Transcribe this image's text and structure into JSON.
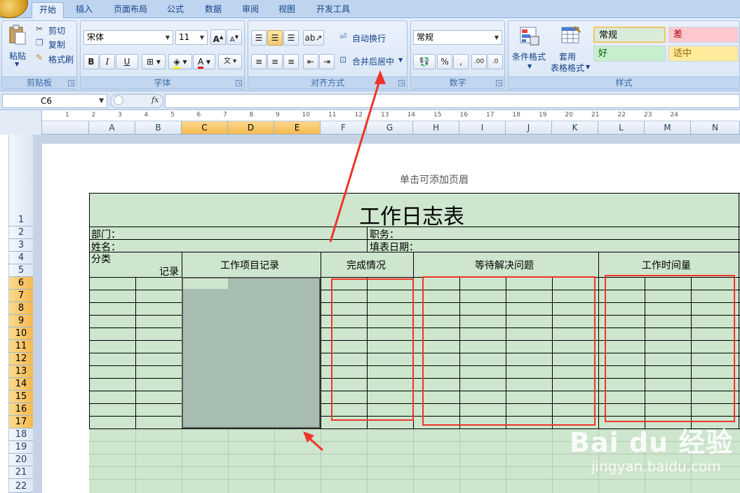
{
  "tabs": [
    "开始",
    "插入",
    "页面布局",
    "公式",
    "数据",
    "审阅",
    "视图",
    "开发工具"
  ],
  "clipboard": {
    "paste": "粘贴",
    "cut": "剪切",
    "copy": "复制",
    "format_painter": "格式刷",
    "label": "剪贴板"
  },
  "font": {
    "name": "宋体",
    "size": "11",
    "bold": "B",
    "italic": "I",
    "underline": "U",
    "label": "字体"
  },
  "alignment": {
    "wrap": "自动换行",
    "merge": "合并后居中",
    "label": "对齐方式"
  },
  "number": {
    "format": "常规",
    "percent": "%",
    "comma": ",",
    "label": "数字"
  },
  "styles": {
    "conditional": "条件格式",
    "table_format": "套用\n表格格式",
    "table_format_line1": "套用",
    "table_format_line2": "表格格式",
    "normal": "常规",
    "bad": "差",
    "good": "好",
    "neutral": "适中",
    "label": "样式",
    "colors": {
      "normal": "#d9ecd9",
      "bad": "#ffc7ce",
      "good": "#c6efce",
      "neutral": "#ffeb9c"
    }
  },
  "name_box": "C6",
  "fx": "fx",
  "columns": [
    "A",
    "B",
    "C",
    "D",
    "E",
    "F",
    "G",
    "H",
    "I",
    "J",
    "K",
    "L",
    "M",
    "N"
  ],
  "selected_columns": [
    "C",
    "D",
    "E"
  ],
  "ruler_numbers": [
    "1",
    "2",
    "3",
    "4",
    "5",
    "6",
    "7",
    "8",
    "9",
    "10",
    "11",
    "12",
    "13",
    "14",
    "15",
    "16",
    "17",
    "18",
    "19",
    "20",
    "21",
    "22",
    "23",
    "24"
  ],
  "rows": [
    "1",
    "2",
    "3",
    "4",
    "5",
    "6",
    "7",
    "8",
    "9",
    "10",
    "11",
    "12",
    "13",
    "14",
    "15",
    "16",
    "17",
    "18",
    "19",
    "20",
    "21",
    "22"
  ],
  "selected_rows": [
    "6",
    "7",
    "8",
    "9",
    "10",
    "11",
    "12",
    "13",
    "14",
    "15",
    "16",
    "17"
  ],
  "sheet": {
    "header_hint": "单击可添加页眉",
    "title": "工作日志表",
    "dept": "部门：",
    "position": "职务：",
    "name": "姓名：",
    "date": "填表日期：",
    "category": "分类",
    "record": "记录",
    "col_work_items": "工作项目记录",
    "col_completion": "完成情况",
    "col_pending": "等待解决问题",
    "col_hours": "工作时间量"
  },
  "watermark": {
    "logo": "Bai du 经验",
    "url": "jingyan.baidu.com"
  },
  "colors": {
    "cell_fill": "#cde6cd",
    "selection": "#a8bdb2",
    "annotation": "#f0342a",
    "header_selected": "#f8c25e"
  }
}
